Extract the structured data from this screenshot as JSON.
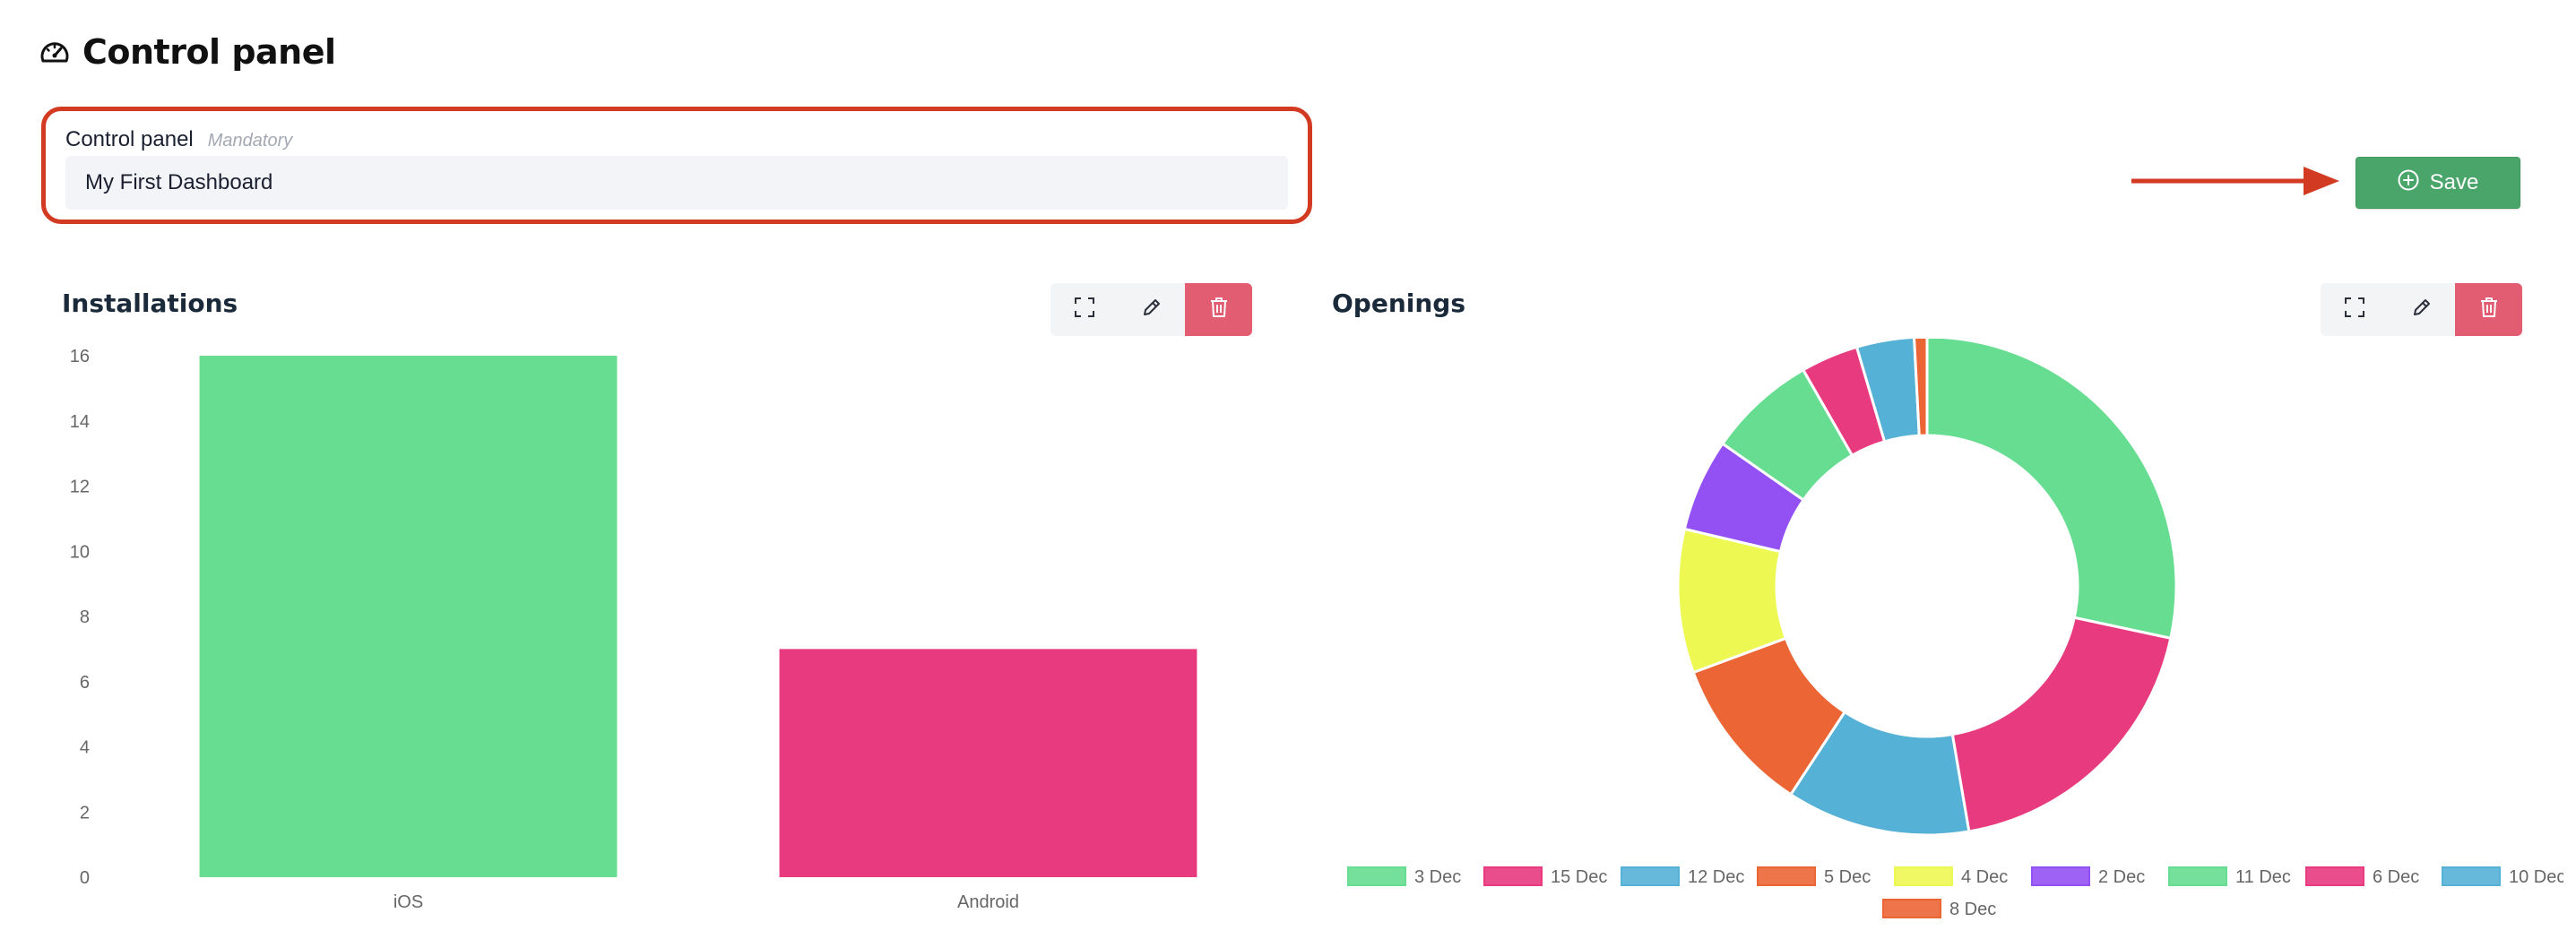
{
  "header": {
    "title": "Control panel",
    "icon": "gauge-icon"
  },
  "name_field": {
    "label": "Control panel",
    "hint": "Mandatory",
    "value": "My First Dashboard"
  },
  "save_button": {
    "label": "Save",
    "icon": "plus-circle-icon",
    "color": "#4aa56a"
  },
  "annotation": {
    "box_color": "#d23a22",
    "arrow_color": "#d23a22"
  },
  "widgets": [
    {
      "title": "Installations",
      "toolbar": [
        "expand-icon",
        "pencil-icon",
        "trash-icon"
      ]
    },
    {
      "title": "Openings",
      "toolbar": [
        "expand-icon",
        "pencil-icon",
        "trash-icon"
      ]
    }
  ],
  "chart_data": [
    {
      "type": "bar",
      "title": "Installations",
      "categories": [
        "iOS",
        "Android"
      ],
      "values": [
        16,
        7
      ],
      "colors": [
        "#66dd91",
        "#e83a7e"
      ],
      "ylim": [
        0,
        16
      ],
      "yticks": [
        "0",
        "2",
        "4",
        "6",
        "8",
        "10",
        "12",
        "14",
        "16"
      ],
      "grid": false,
      "legend": "none"
    },
    {
      "type": "pie",
      "title": "Openings",
      "donut": true,
      "labels": [
        "3 Dec",
        "15 Dec",
        "12 Dec",
        "5 Dec",
        "4 Dec",
        "2 Dec",
        "11 Dec",
        "6 Dec",
        "10 Dec",
        "8 Dec"
      ],
      "values": [
        27.4,
        18.3,
        11.5,
        9.8,
        9.0,
        5.8,
        6.8,
        3.6,
        3.6,
        0.8
      ],
      "colors": [
        "#66dd91",
        "#e83a7e",
        "#55b1d6",
        "#ec6535",
        "#eef853",
        "#9351f3",
        "#66dd91",
        "#e83a7e",
        "#55b1d6",
        "#ec6535"
      ],
      "legend": "bottom"
    }
  ]
}
